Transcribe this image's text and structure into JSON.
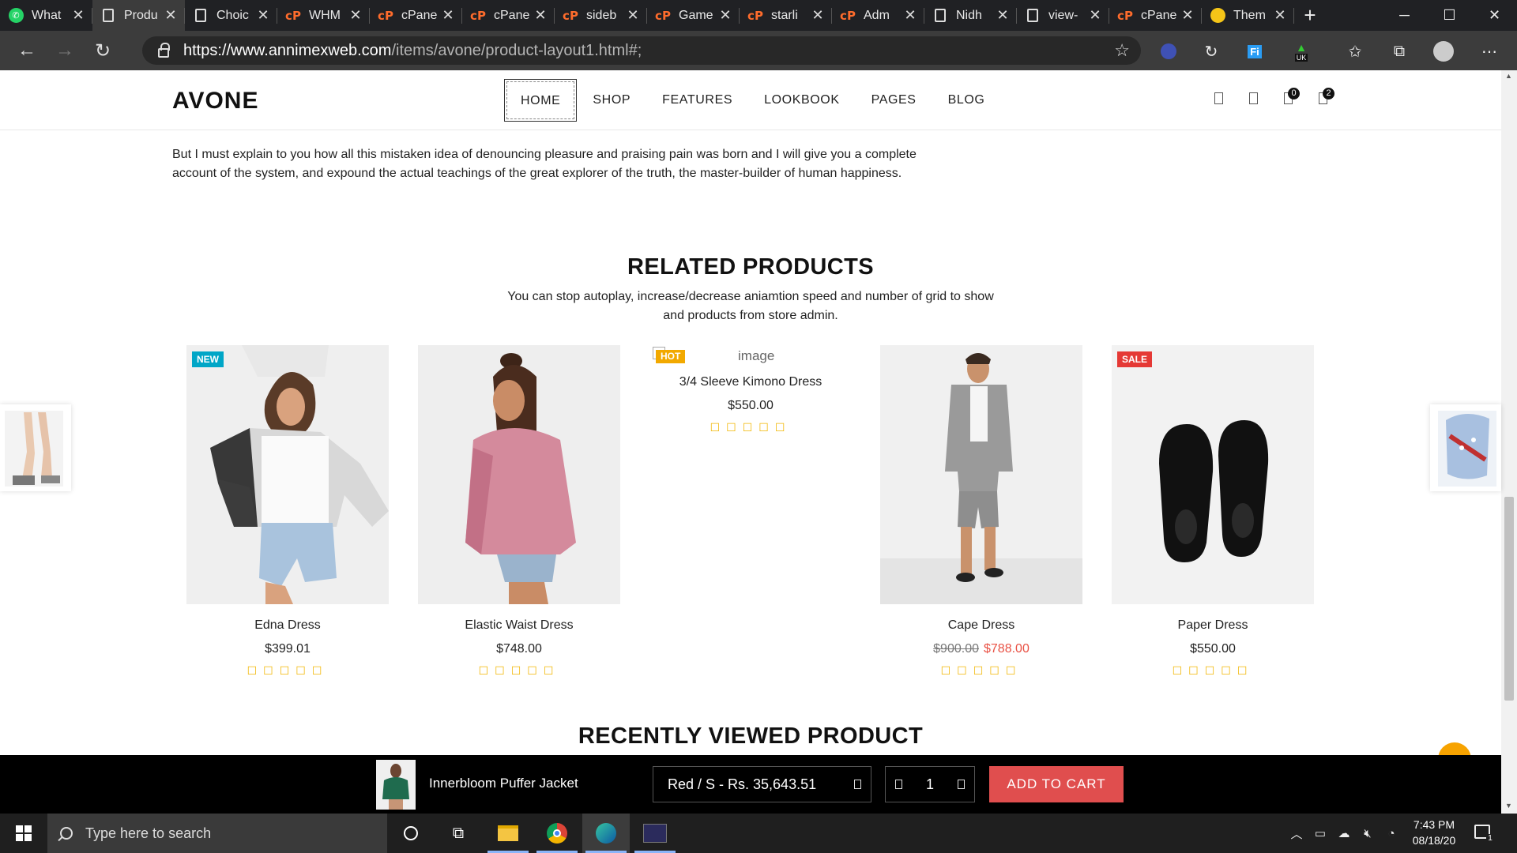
{
  "browser": {
    "tabs": [
      {
        "label": "What",
        "icon": "whatsapp-icon",
        "active": false
      },
      {
        "label": "Produ",
        "icon": "page-icon",
        "active": true
      },
      {
        "label": "Choic",
        "icon": "page-icon",
        "active": false
      },
      {
        "label": "WHM",
        "icon": "cpanel-icon",
        "active": false
      },
      {
        "label": "cPane",
        "icon": "cpanel-icon",
        "active": false
      },
      {
        "label": "cPane",
        "icon": "cpanel-icon",
        "active": false
      },
      {
        "label": "sideb",
        "icon": "cpanel-icon",
        "active": false
      },
      {
        "label": "Game",
        "icon": "cpanel-icon",
        "active": false
      },
      {
        "label": "starli",
        "icon": "cpanel-icon",
        "active": false
      },
      {
        "label": "Adm",
        "icon": "cpanel-icon",
        "active": false
      },
      {
        "label": "Nidh",
        "icon": "page-icon",
        "active": false
      },
      {
        "label": "view-",
        "icon": "page-icon",
        "active": false
      },
      {
        "label": "cPane",
        "icon": "cpanel-icon",
        "active": false
      },
      {
        "label": "Them",
        "icon": "emoji-icon",
        "active": false
      }
    ],
    "url_main": "https://www.annimexweb.com",
    "url_path": "/items/avone/product-layout1.html#;",
    "ext_badge": "UK"
  },
  "site": {
    "logo": "AVONE",
    "menu": [
      "HOME",
      "SHOP",
      "FEATURES",
      "LOOKBOOK",
      "PAGES",
      "BLOG"
    ],
    "wishlist_count": "0",
    "cart_count": "2"
  },
  "description": "But I must explain to you how all this mistaken idea of denouncing pleasure and praising pain was born and I will give you a complete account of the system, and expound the actual teachings of the great explorer of the truth, the master-builder of human happiness.",
  "related": {
    "title": "RELATED PRODUCTS",
    "subtitle": "You can stop autoplay, increase/decrease aniamtion speed and number of grid to show and products from store admin.",
    "stars": "☐☐☐☐☐",
    "products": [
      {
        "name": "Edna Dress",
        "price": "$399.01",
        "tag": "NEW"
      },
      {
        "name": "Elastic Waist Dress",
        "price": "$748.00",
        "tag": ""
      },
      {
        "name": "3/4 Sleeve Kimono Dress",
        "price": "$550.00",
        "tag": "HOT",
        "img_alt": "image"
      },
      {
        "name": "Cape Dress",
        "old_price": "$900.00",
        "price": "$788.00",
        "tag": ""
      },
      {
        "name": "Paper Dress",
        "price": "$550.00",
        "tag": "SALE"
      }
    ]
  },
  "recent_title": "RECENTLY VIEWED PRODUCT",
  "sticky": {
    "product": "Innerbloom Puffer Jacket",
    "variant": "Red / S - Rs. 35,643.51",
    "qty": "1",
    "add_label": "ADD TO CART"
  },
  "taskbar": {
    "search_placeholder": "Type here to search",
    "time": "7:43 PM",
    "date": "08/18/20",
    "notifications": "1"
  },
  "colors": {
    "accent": "#e04e4e",
    "new_tag": "#00a6c7",
    "sale_tag": "#e53935",
    "hot_tag": "#f2a900",
    "stars": "#f2b705",
    "fab": "#f7a300"
  }
}
